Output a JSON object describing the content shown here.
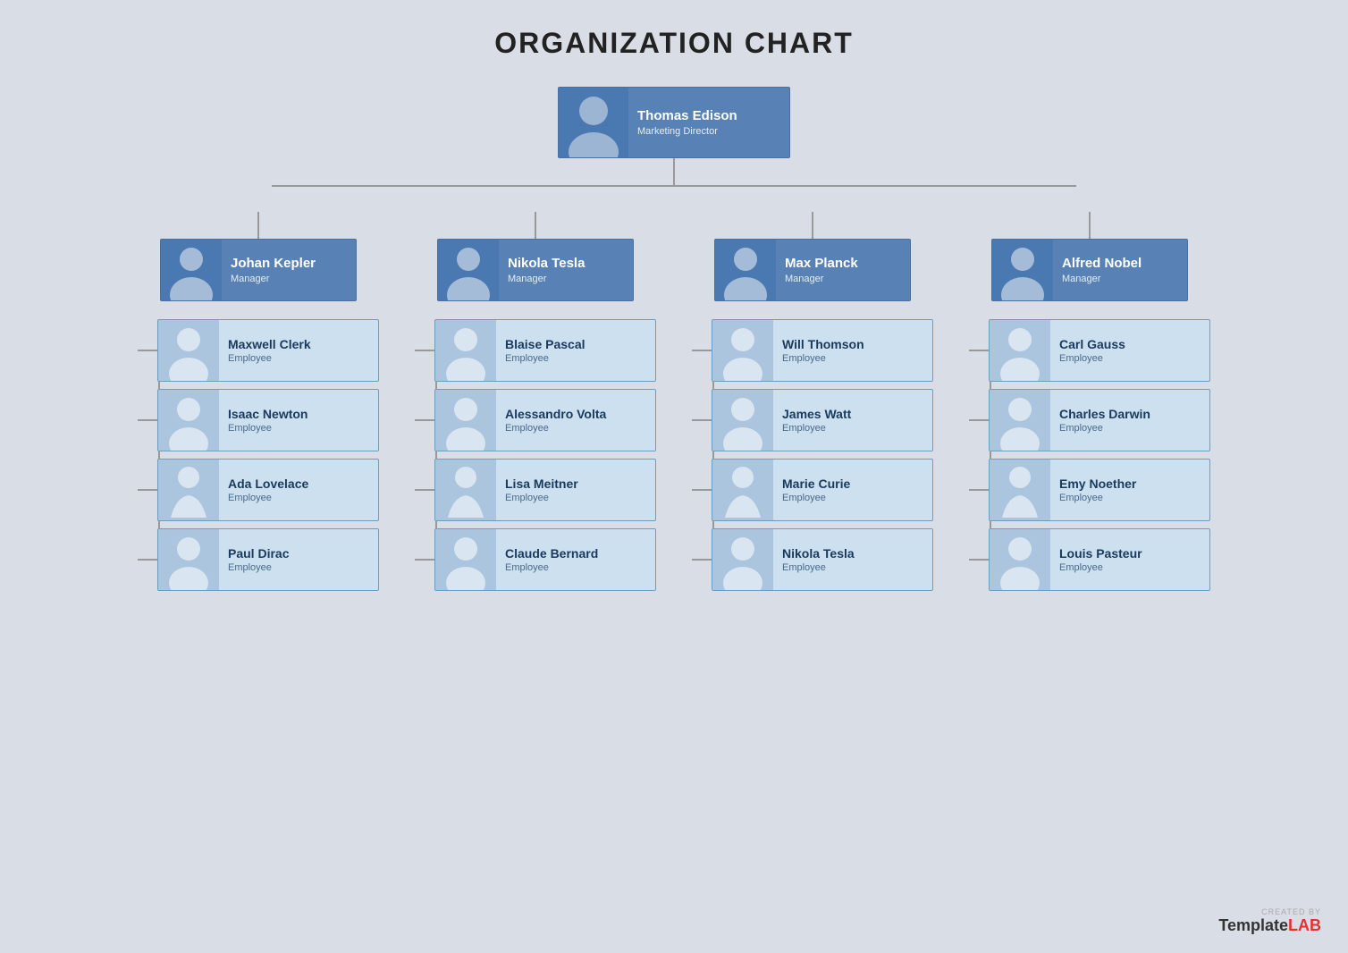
{
  "title": "ORGANIZATION CHART",
  "root": {
    "name": "Thomas Edison",
    "role": "Marketing Director"
  },
  "managers": [
    {
      "name": "Johan Kepler",
      "role": "Manager",
      "employees": [
        {
          "name": "Maxwell Clerk",
          "role": "Employee",
          "gender": "male"
        },
        {
          "name": "Isaac Newton",
          "role": "Employee",
          "gender": "male"
        },
        {
          "name": "Ada Lovelace",
          "role": "Employee",
          "gender": "female"
        },
        {
          "name": "Paul Dirac",
          "role": "Employee",
          "gender": "male"
        }
      ]
    },
    {
      "name": "Nikola Tesla",
      "role": "Manager",
      "employees": [
        {
          "name": "Blaise Pascal",
          "role": "Employee",
          "gender": "male"
        },
        {
          "name": "Alessandro Volta",
          "role": "Employee",
          "gender": "male"
        },
        {
          "name": "Lisa Meitner",
          "role": "Employee",
          "gender": "female"
        },
        {
          "name": "Claude Bernard",
          "role": "Employee",
          "gender": "male"
        }
      ]
    },
    {
      "name": "Max Planck",
      "role": "Manager",
      "employees": [
        {
          "name": "Will Thomson",
          "role": "Employee",
          "gender": "male"
        },
        {
          "name": "James Watt",
          "role": "Employee",
          "gender": "male"
        },
        {
          "name": "Marie Curie",
          "role": "Employee",
          "gender": "female"
        },
        {
          "name": "Nikola Tesla",
          "role": "Employee",
          "gender": "male"
        }
      ]
    },
    {
      "name": "Alfred Nobel",
      "role": "Manager",
      "employees": [
        {
          "name": "Carl Gauss",
          "role": "Employee",
          "gender": "male"
        },
        {
          "name": "Charles Darwin",
          "role": "Employee",
          "gender": "male"
        },
        {
          "name": "Emy Noether",
          "role": "Employee",
          "gender": "female"
        },
        {
          "name": "Louis Pasteur",
          "role": "Employee",
          "gender": "male"
        }
      ]
    }
  ],
  "watermark": {
    "created_by": "CREATED BY",
    "brand_prefix": "Template",
    "brand_suffix": "LAB"
  },
  "colors": {
    "bg": "#d8dde6",
    "manager_card": "#5882b5",
    "employee_card": "#cce0f0",
    "connector": "#999999",
    "avatar_manager": "#4a78b0",
    "avatar_employee": "#aac5dd"
  }
}
